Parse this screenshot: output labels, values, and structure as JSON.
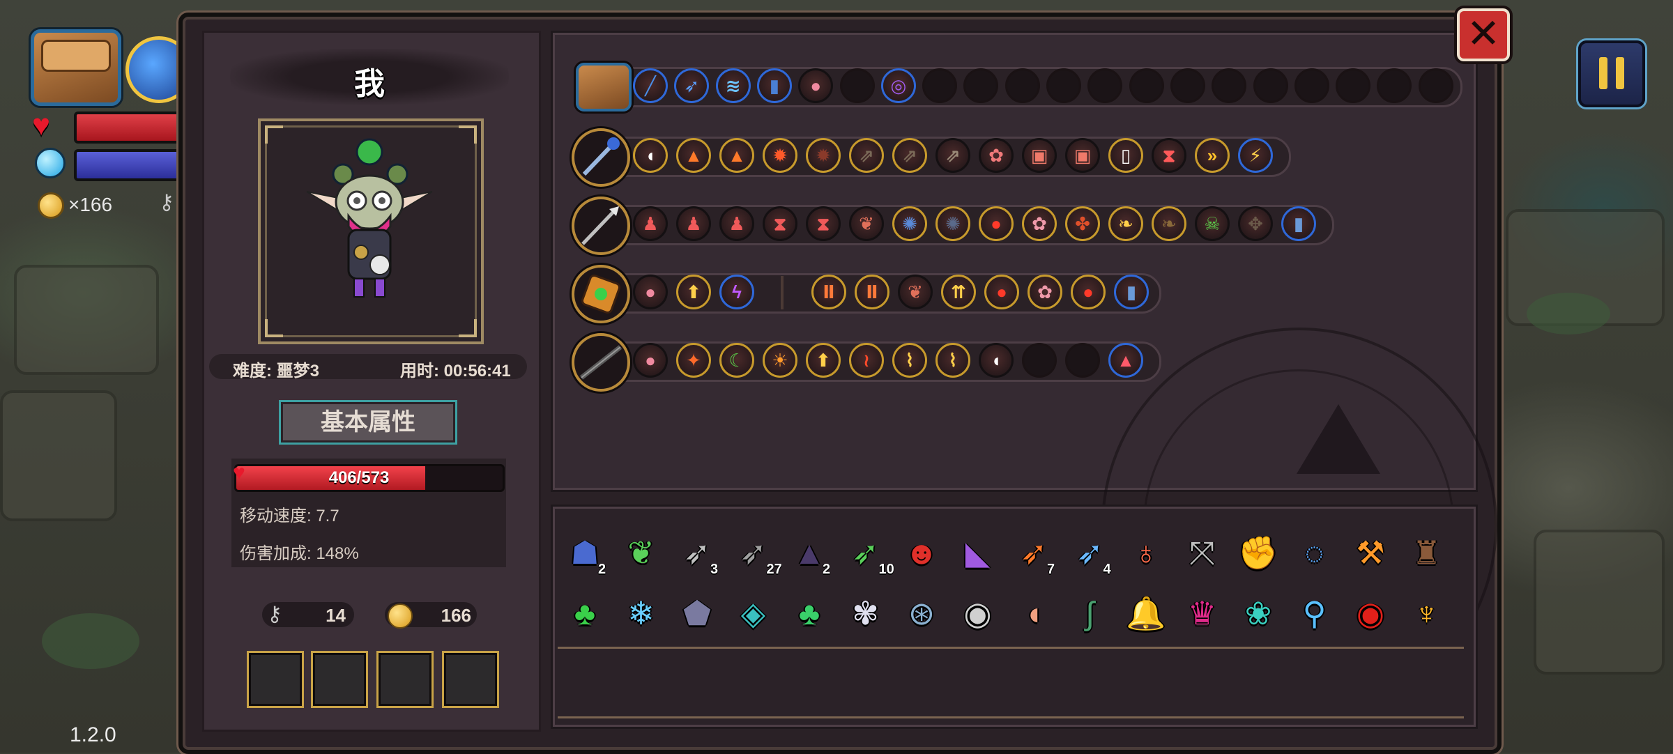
{
  "version": "1.2.0",
  "hud": {
    "gold_text": "×166",
    "hp_color": "#d8262f",
    "mp_color": "#3e43c2"
  },
  "panel": {
    "player_name": "我",
    "difficulty": "难度: 噩梦3",
    "time_used": "用时: 00:56:41",
    "tab_label": "基本属性",
    "hp_text": "406/573",
    "hp_fraction": 0.709,
    "move_speed": "移动速度: 7.7",
    "damage_bonus": "伤害加成: 148%",
    "keys": "14",
    "coins": "166"
  },
  "rows": [
    {
      "name": "bag",
      "icons": [
        {
          "n": "wand-icon",
          "g": "╱",
          "c": "#4a8ee8",
          "b": "blue"
        },
        {
          "n": "feather-blade-icon",
          "g": "➶",
          "c": "#5aa0ff",
          "b": "blue"
        },
        {
          "n": "wave-icon",
          "g": "≋",
          "c": "#6cc3ff",
          "b": "blue"
        },
        {
          "n": "canister-icon",
          "g": "▮",
          "c": "#4a7fd4",
          "b": "blue"
        },
        {
          "n": "creature-icon",
          "g": "●",
          "c": "#f08aa0",
          "b": "plain"
        },
        {
          "n": "empty-slot",
          "g": "",
          "c": "",
          "b": "empty"
        },
        {
          "n": "vortex-icon",
          "g": "◎",
          "c": "#a05cf0",
          "b": "blue"
        },
        {
          "n": "empty-slot",
          "g": "",
          "c": "",
          "b": "empty"
        },
        {
          "n": "empty-slot",
          "g": "",
          "c": "",
          "b": "empty"
        },
        {
          "n": "empty-slot",
          "g": "",
          "c": "",
          "b": "empty"
        },
        {
          "n": "empty-slot",
          "g": "",
          "c": "",
          "b": "empty"
        },
        {
          "n": "empty-slot",
          "g": "",
          "c": "",
          "b": "empty"
        },
        {
          "n": "empty-slot",
          "g": "",
          "c": "",
          "b": "empty"
        },
        {
          "n": "empty-slot",
          "g": "",
          "c": "",
          "b": "empty"
        },
        {
          "n": "empty-slot",
          "g": "",
          "c": "",
          "b": "empty"
        },
        {
          "n": "empty-slot",
          "g": "",
          "c": "",
          "b": "empty"
        },
        {
          "n": "empty-slot",
          "g": "",
          "c": "",
          "b": "empty"
        },
        {
          "n": "empty-slot",
          "g": "",
          "c": "",
          "b": "empty"
        },
        {
          "n": "empty-slot",
          "g": "",
          "c": "",
          "b": "empty"
        },
        {
          "n": "empty-slot",
          "g": "",
          "c": "",
          "b": "empty"
        }
      ]
    },
    {
      "name": "staff",
      "icons": [
        {
          "n": "mouse-icon",
          "g": "◖",
          "c": "#ffffff",
          "b": "gold"
        },
        {
          "n": "triple-up-icon",
          "g": "▲",
          "c": "#ff7a2a",
          "b": "gold"
        },
        {
          "n": "triple-up-icon",
          "g": "▲",
          "c": "#ff7a2a",
          "b": "gold"
        },
        {
          "n": "burst-icon",
          "g": "✹",
          "c": "#ff5a2a",
          "b": "gold"
        },
        {
          "n": "burst-dark-icon",
          "g": "✹",
          "c": "#8a3a2a",
          "b": "gold"
        },
        {
          "n": "arrows-dark-icon",
          "g": "⇗",
          "c": "#7a6a58",
          "b": "gold"
        },
        {
          "n": "arrows-dark-icon",
          "g": "⇗",
          "c": "#7a6a58",
          "b": "gold"
        },
        {
          "n": "arrows-dark-icon",
          "g": "⇗",
          "c": "#9a8a78",
          "b": "plain"
        },
        {
          "n": "flower-icon",
          "g": "✿",
          "c": "#f07a7a",
          "b": "plain"
        },
        {
          "n": "chest-icon",
          "g": "▣",
          "c": "#f07a6a",
          "b": "plain"
        },
        {
          "n": "chest-icon",
          "g": "▣",
          "c": "#f07a6a",
          "b": "plain"
        },
        {
          "n": "card-icon",
          "g": "▯",
          "c": "#ffffff",
          "b": "gold"
        },
        {
          "n": "hourglass-icon",
          "g": "⧗",
          "c": "#ff5a5a",
          "b": "plain"
        },
        {
          "n": "fast-forward-icon",
          "g": "»",
          "c": "#ffc22a",
          "b": "gold"
        },
        {
          "n": "bolt-icon",
          "g": "⚡",
          "c": "#ffd24a",
          "b": "blue"
        }
      ]
    },
    {
      "name": "spear",
      "icons": [
        {
          "n": "figure-icon",
          "g": "♟",
          "c": "#f05a5a",
          "b": "plain"
        },
        {
          "n": "figure-icon",
          "g": "♟",
          "c": "#f05a5a",
          "b": "plain"
        },
        {
          "n": "figure-icon",
          "g": "♟",
          "c": "#f05a5a",
          "b": "plain"
        },
        {
          "n": "hourglass-icon",
          "g": "⧗",
          "c": "#f05a5a",
          "b": "plain"
        },
        {
          "n": "hourglass-icon",
          "g": "⧗",
          "c": "#f05a5a",
          "b": "plain"
        },
        {
          "n": "meat-icon",
          "g": "❦",
          "c": "#e0705a",
          "b": "plain"
        },
        {
          "n": "swirl-icon",
          "g": "✺",
          "c": "#5a8ad8",
          "b": "gold"
        },
        {
          "n": "swirl-dark-icon",
          "g": "✺",
          "c": "#5a6a8a",
          "b": "gold"
        },
        {
          "n": "cherry-icon",
          "g": "●",
          "c": "#ff3a2a",
          "b": "gold"
        },
        {
          "n": "bunny-icon",
          "g": "✿",
          "c": "#f09aaa",
          "b": "gold"
        },
        {
          "n": "triad-icon",
          "g": "✤",
          "c": "#e0502a",
          "b": "gold"
        },
        {
          "n": "leaf-icon",
          "g": "❧",
          "c": "#ffcf4a",
          "b": "gold"
        },
        {
          "n": "leaf-dark-icon",
          "g": "❧",
          "c": "#8a6a3a",
          "b": "gold"
        },
        {
          "n": "skull-icon",
          "g": "☠",
          "c": "#5ad04a",
          "b": "plain"
        },
        {
          "n": "knot-icon",
          "g": "✥",
          "c": "#6a5a4a",
          "b": "plain"
        },
        {
          "n": "canister-icon",
          "g": "▮",
          "c": "#6a9ad8",
          "b": "blue"
        }
      ]
    },
    {
      "name": "book",
      "icons": [
        {
          "n": "creature-icon",
          "g": "●",
          "c": "#f08aa0",
          "b": "plain"
        },
        {
          "n": "arrow-up-icon",
          "g": "⬆",
          "c": "#ffcf4a",
          "b": "gold"
        },
        {
          "n": "lightning-orb-icon",
          "g": "ϟ",
          "c": "#c05aff",
          "b": "blue"
        },
        {
          "n": "pause-token-icon",
          "g": "Ⅱ",
          "c": "#ff7a3a",
          "b": "gold"
        },
        {
          "n": "pause-token-icon",
          "g": "Ⅱ",
          "c": "#ff7a3a",
          "b": "gold"
        },
        {
          "n": "meat-icon",
          "g": "❦",
          "c": "#e0705a",
          "b": "plain"
        },
        {
          "n": "double-arrow-icon",
          "g": "⇈",
          "c": "#ffcf4a",
          "b": "gold"
        },
        {
          "n": "cherry-icon",
          "g": "●",
          "c": "#ff3a2a",
          "b": "gold"
        },
        {
          "n": "bunny-icon",
          "g": "✿",
          "c": "#f09aaa",
          "b": "gold"
        },
        {
          "n": "cherry-icon",
          "g": "●",
          "c": "#ff3a2a",
          "b": "gold"
        },
        {
          "n": "canister-icon",
          "g": "▮",
          "c": "#6a9ad8",
          "b": "blue"
        }
      ]
    },
    {
      "name": "rifle",
      "icons": [
        {
          "n": "creature-icon",
          "g": "●",
          "c": "#f08aa0",
          "b": "plain"
        },
        {
          "n": "flame-claw-icon",
          "g": "✦",
          "c": "#ff6a2a",
          "b": "gold"
        },
        {
          "n": "crescent-icon",
          "g": "☾",
          "c": "#5ad04a",
          "b": "gold"
        },
        {
          "n": "sun-icon",
          "g": "☀",
          "c": "#ff9a2a",
          "b": "gold"
        },
        {
          "n": "arrow-up-icon",
          "g": "⬆",
          "c": "#ffcf4a",
          "b": "gold"
        },
        {
          "n": "serpent-icon",
          "g": "≀",
          "c": "#ff4a2a",
          "b": "gold"
        },
        {
          "n": "stairs-icon",
          "g": "⌇",
          "c": "#ffcf4a",
          "b": "gold"
        },
        {
          "n": "stairs-icon",
          "g": "⌇",
          "c": "#ffcf4a",
          "b": "gold"
        },
        {
          "n": "mouse-icon",
          "g": "◖",
          "c": "#ffffff",
          "b": "plain"
        },
        {
          "n": "empty-slot",
          "g": "",
          "c": "",
          "b": "empty"
        },
        {
          "n": "empty-slot",
          "g": "",
          "c": "",
          "b": "empty"
        },
        {
          "n": "tooth-icon",
          "g": "▲",
          "c": "#ff5a6a",
          "b": "blue"
        }
      ]
    }
  ],
  "items_row1": [
    {
      "n": "helmet-item-icon",
      "g": "☗",
      "c": "#4a6ad0",
      "count": "2"
    },
    {
      "n": "leaf-blade-item-icon",
      "g": "❦",
      "c": "#5ad05a",
      "count": ""
    },
    {
      "n": "arrow-item-icon",
      "g": "➶",
      "c": "#c0c0c0",
      "count": "3"
    },
    {
      "n": "arrow-item-icon",
      "g": "➶",
      "c": "#a0a0a0",
      "count": "27"
    },
    {
      "n": "cloak-item-icon",
      "g": "▲",
      "c": "#4a3a6a",
      "count": "2"
    },
    {
      "n": "green-arrow-item-icon",
      "g": "➶",
      "c": "#5ad05a",
      "count": "10"
    },
    {
      "n": "demon-mask-item-icon",
      "g": "☻",
      "c": "#e0302a",
      "count": ""
    },
    {
      "n": "boot-item-icon",
      "g": "◣",
      "c": "#a05ae0",
      "count": ""
    },
    {
      "n": "flame-arrow-item-icon",
      "g": "➶",
      "c": "#ff7a2a",
      "count": "7"
    },
    {
      "n": "ice-arrow-item-icon",
      "g": "➶",
      "c": "#6ab8ff",
      "count": "4"
    },
    {
      "n": "amulet-item-icon",
      "g": "♁",
      "c": "#ff6a4a",
      "count": ""
    },
    {
      "n": "crossbow-item-icon",
      "g": "⤧",
      "c": "#c0c0c0",
      "count": ""
    },
    {
      "n": "gauntlet-item-icon",
      "g": "✊",
      "c": "#ffb82a",
      "count": ""
    },
    {
      "n": "ring-item-icon",
      "g": "◌",
      "c": "#5aa8ff",
      "count": ""
    },
    {
      "n": "pickaxe-item-icon",
      "g": "⚒",
      "c": "#ff9a2a",
      "count": ""
    },
    {
      "n": "fur-cloak-item-icon",
      "g": "♜",
      "c": "#8a5a3a",
      "count": ""
    }
  ],
  "items_row2": [
    {
      "n": "crystal-item-icon",
      "g": "♣",
      "c": "#3ad04a",
      "count": ""
    },
    {
      "n": "frost-bow-item-icon",
      "g": "❄",
      "c": "#6ad0ff",
      "count": ""
    },
    {
      "n": "stone-item-icon",
      "g": "⬟",
      "c": "#7a7aa0",
      "count": ""
    },
    {
      "n": "dice-item-icon",
      "g": "◈",
      "c": "#3ac0c0",
      "count": ""
    },
    {
      "n": "clover-item-icon",
      "g": "♣",
      "c": "#3ad06a",
      "count": ""
    },
    {
      "n": "crystal-flower-item-icon",
      "g": "✾",
      "c": "#e0e0f0",
      "count": ""
    },
    {
      "n": "compass-item-icon",
      "g": "⊛",
      "c": "#8ab0d0",
      "count": ""
    },
    {
      "n": "goggles-item-icon",
      "g": "◉",
      "c": "#d0d0d0",
      "count": ""
    },
    {
      "n": "bean-item-icon",
      "g": "◖",
      "c": "#f0a080",
      "count": ""
    },
    {
      "n": "worm-item-icon",
      "g": "∫",
      "c": "#4aa070",
      "count": ""
    },
    {
      "n": "bell-item-icon",
      "g": "🔔",
      "c": "#ffc22a",
      "count": ""
    },
    {
      "n": "spiky-mask-item-icon",
      "g": "♛",
      "c": "#e02a8a",
      "count": ""
    },
    {
      "n": "shell-item-icon",
      "g": "❀",
      "c": "#3ad0c0",
      "count": ""
    },
    {
      "n": "magnifier-item-icon",
      "g": "⚲",
      "c": "#5ac0ff",
      "count": ""
    },
    {
      "n": "red-eye-item-icon",
      "g": "◉",
      "c": "#e0201a",
      "count": ""
    },
    {
      "n": "chalice-item-icon",
      "g": "♆",
      "c": "#ffb82a",
      "count": ""
    }
  ]
}
